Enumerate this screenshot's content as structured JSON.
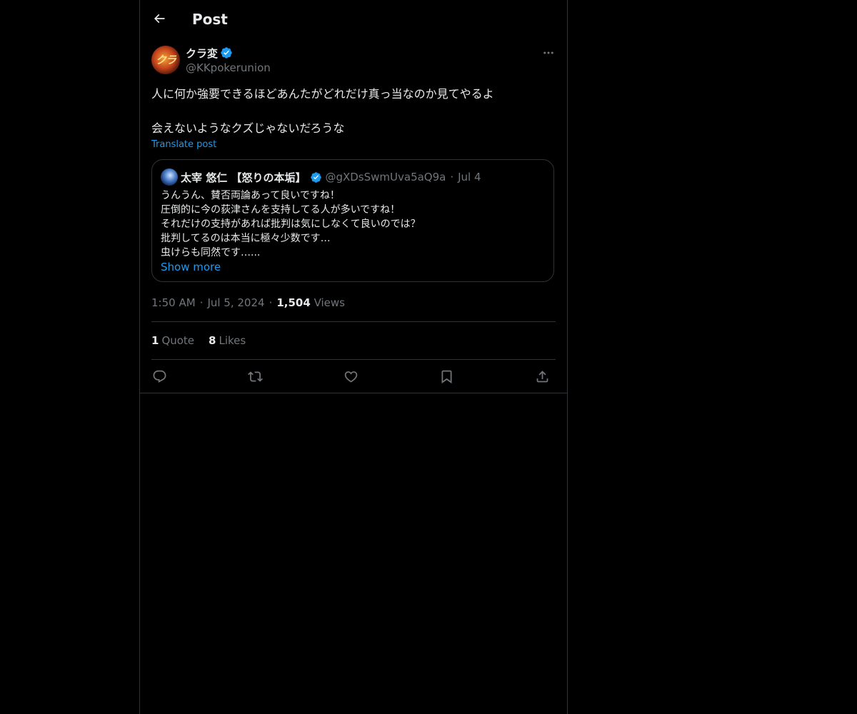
{
  "header": {
    "title": "Post",
    "back_icon": "arrow-left-icon"
  },
  "post": {
    "author": {
      "display_name": "クラ変",
      "handle": "@KKpokerunion",
      "verified": true,
      "avatar_text": "クラ"
    },
    "text": "人に何か強要できるほどあんたがどれだけ真っ当なのか見てやるよ\n\n会えないようなクズじゃないだろうな",
    "translate_label": "Translate post",
    "quote": {
      "display_name": "太宰 悠仁 【怒りの本垢】",
      "handle": "@gXDsSwmUva5aQ9a",
      "separator": "·",
      "date": "Jul 4",
      "verified": true,
      "lines": [
        "うんうん、賛否両論あって良いですね！",
        "圧倒的に今の荻津さんを支持してる人が多いですね！",
        "それだけの支持があれば批判は気にしなくて良いのでは？",
        "批判してるのは本当に極々少数です…",
        "虫けらも同然です…..."
      ],
      "show_more": "Show more"
    },
    "meta": {
      "time": "1:50 AM",
      "separator": "·",
      "date": "Jul 5, 2024",
      "views_count": "1,504",
      "views_label": "Views"
    },
    "stats": {
      "quotes_count": "1",
      "quotes_label": "Quote",
      "likes_count": "8",
      "likes_label": "Likes"
    },
    "actions": [
      "reply-icon",
      "repost-icon",
      "like-icon",
      "bookmark-icon",
      "share-icon"
    ]
  },
  "colors": {
    "background": "#000000",
    "text": "#e7e9ea",
    "secondary": "#71767b",
    "accent": "#1d9bf0",
    "border": "#2f3336"
  }
}
